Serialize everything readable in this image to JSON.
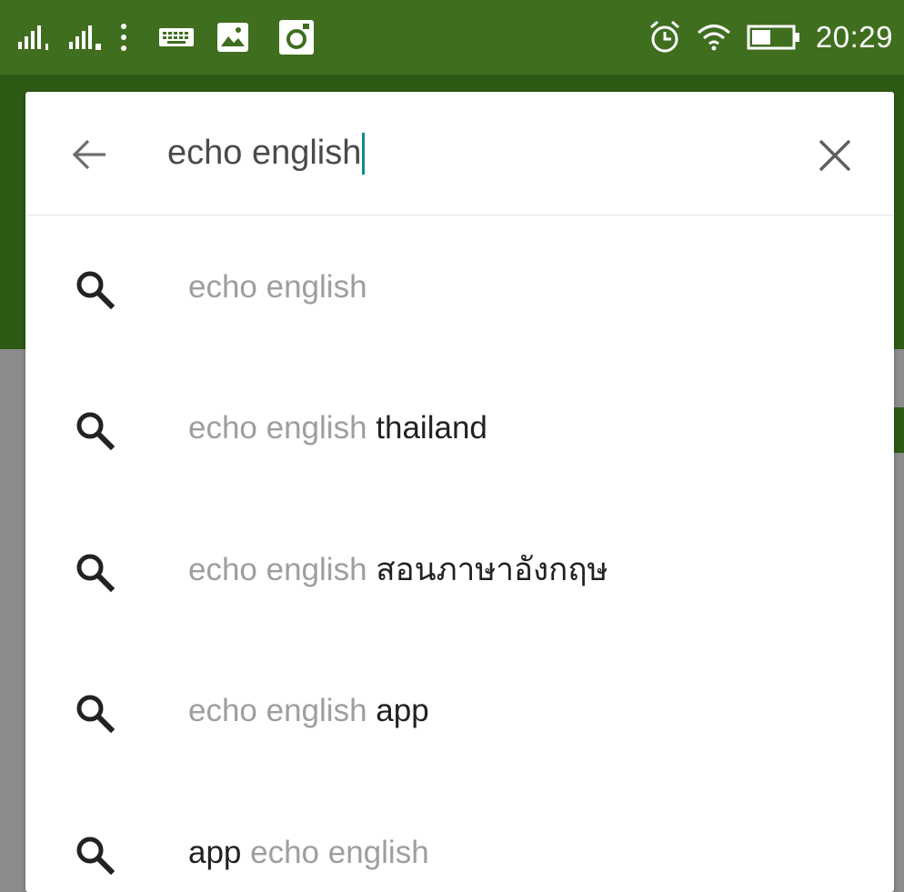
{
  "status_bar": {
    "time": "20:29",
    "icons": [
      "signal-sim1-icon",
      "signal-sim2-icon",
      "more-vert-icon",
      "keyboard-icon",
      "image-icon",
      "instagram-icon",
      "alarm-icon",
      "wifi-icon",
      "battery-icon"
    ],
    "colors": {
      "background": "#3f6e1f",
      "foreground": "#ffffff"
    }
  },
  "search": {
    "query": "echo english",
    "back_icon": "arrow-back-icon",
    "clear_icon": "close-icon",
    "caret_color": "#0b8f88"
  },
  "suggestions": [
    {
      "icon": "search-icon",
      "muted_prefix": "",
      "muted": "echo english",
      "strong": ""
    },
    {
      "icon": "search-icon",
      "muted_prefix": "",
      "muted": "echo english",
      "strong": " thailand"
    },
    {
      "icon": "search-icon",
      "muted_prefix": "",
      "muted": "echo english",
      "strong": " สอนภาษาอังกฤษ"
    },
    {
      "icon": "search-icon",
      "muted_prefix": "",
      "muted": "echo english",
      "strong": " app"
    },
    {
      "icon": "search-icon",
      "strong_prefix": "app",
      "muted": " echo english",
      "strong": ""
    }
  ],
  "colors": {
    "app_green": "#2d5a14",
    "muted_text": "#9e9e9e",
    "strong_text": "#212121"
  }
}
